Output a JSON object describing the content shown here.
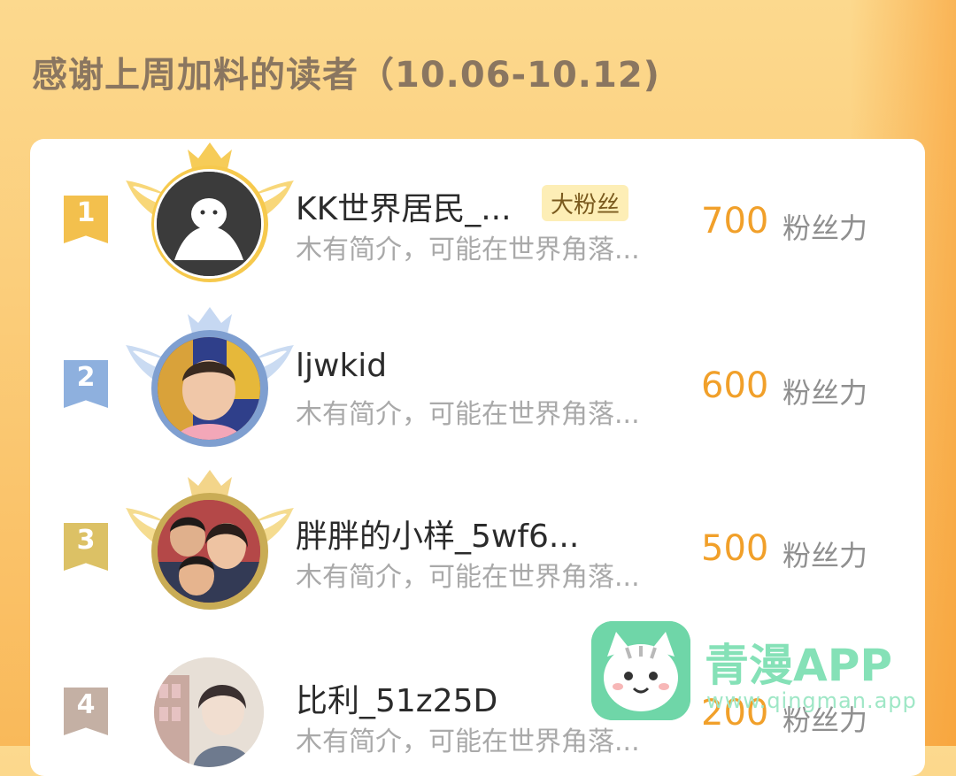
{
  "header": {
    "title": "感谢上周加料的读者（10.06-10.12)"
  },
  "colors": {
    "rank_1": "#f3c04d",
    "rank_2": "#8eb0de",
    "rank_3": "#dcc165",
    "rank_4": "#c4b0a4",
    "score": "#f1a02a",
    "badge_bg": "#fdeeb6"
  },
  "readers": [
    {
      "rank": "1",
      "name": "KK世界居民_...",
      "badge": "大粉丝",
      "description": "木有简介，可能在世界角落...",
      "score": "700",
      "unit": "粉丝力"
    },
    {
      "rank": "2",
      "name": "ljwkid",
      "description": "木有简介，可能在世界角落...",
      "score": "600",
      "unit": "粉丝力"
    },
    {
      "rank": "3",
      "name": "胖胖的小样_5wf6...",
      "description": "木有简介，可能在世界角落...",
      "score": "500",
      "unit": "粉丝力"
    },
    {
      "rank": "4",
      "name": "比利_51z25D",
      "description": "木有简介，可能在世界角落...",
      "score": "200",
      "unit": "粉丝力"
    }
  ],
  "watermark": {
    "title": "青漫APP",
    "url": "www.qingman.app",
    "logo_icon": "cat-icon"
  }
}
